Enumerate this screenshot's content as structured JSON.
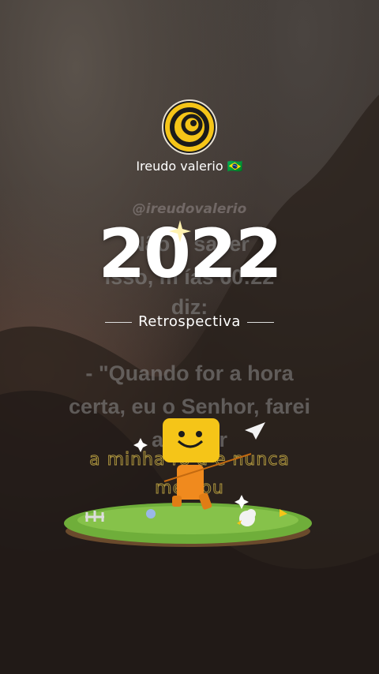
{
  "profile": {
    "name": "Ireudo valerio",
    "flag": "🇧🇷",
    "avatar": "logo-circle-icon"
  },
  "background_text": {
    "handle": "@ireudovalerio",
    "line1": "Não s          sa ler",
    "line2": "isso, m          ías 60:22",
    "line3": "diz:",
    "line4": "- \"Quando for a hora",
    "line5": "certa, eu o Senhor, farei",
    "line6": "acon        er"
  },
  "retrospective": {
    "year": "2022",
    "label": "Retrospectiva"
  },
  "lyrics": {
    "line1": "a minha ro   a e nunca",
    "line2": "me     xou"
  },
  "colors": {
    "accent_yellow": "#f5c518",
    "grass": "#6fae3a",
    "character_orange": "#f08a1e"
  }
}
